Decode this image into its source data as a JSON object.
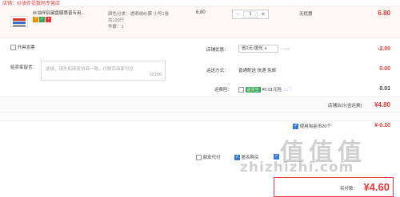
{
  "shop": {
    "name": "店铺：纱油伴侣数码专营店"
  },
  "item": {
    "title": "纱油伴侣键盘膜惠普专用...",
    "sku": [
      "颜色分类：透明绒纱膜 小号1卷",
      "共120只",
      "件数：1"
    ],
    "unit_price": "6.80",
    "quantity": "1",
    "minus": "−",
    "plus": "+",
    "shipping_note": "无优惠",
    "subtotal": "6.80"
  },
  "options": {
    "invoice_label": "开具发票",
    "memo_label": "给卖家留言：",
    "memo_placeholder": "选填，请先和商家协商一致，付款后商家可见",
    "memo_count": "0/200",
    "store_discount_label": "店铺优惠：",
    "store_discount_value": "省2元:拔光 ∨",
    "store_discount_amount": "-2.00",
    "delivery_label": "运送方式：",
    "delivery_value": "普通配送 快递 免邮",
    "delivery_amount": "0.00",
    "insurance_label": "运费险：",
    "insurance_tag": "退货宝",
    "insurance_value": "¥0.01元险",
    "insurance_amount": "0.01"
  },
  "total": {
    "label": "店铺合计(含运费)",
    "amount": "¥4.80"
  },
  "coins": {
    "label": "使用淘金币20个",
    "amount": "¥-0.20"
  },
  "bottom": {
    "pay_for_other": "朋友代付",
    "anonymous": "匿名购买",
    "pay_label": "实付款：",
    "pay_amount": "¥4.60"
  },
  "watermark": {
    "text": "值值值",
    "url": "zhizhizhi.com"
  },
  "colors": {
    "accent": "#e4393c",
    "check": "#3a7bd5"
  }
}
